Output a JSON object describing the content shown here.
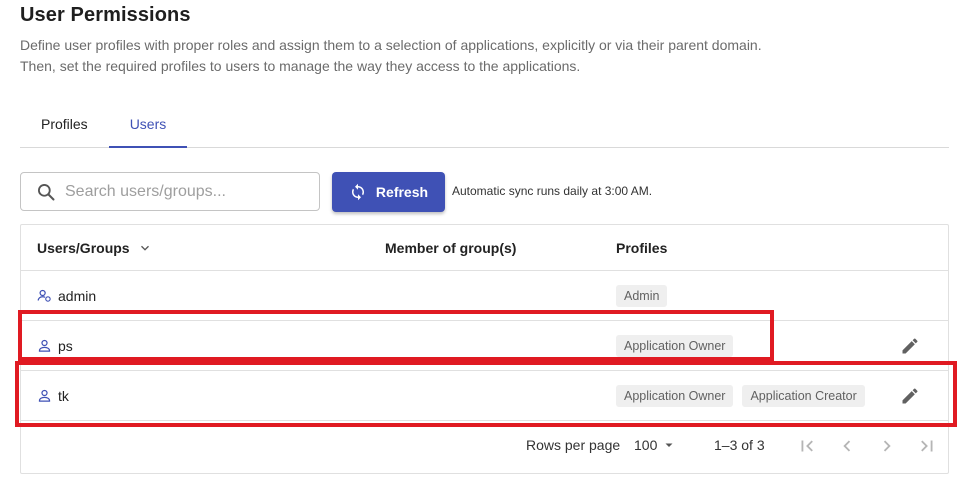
{
  "page": {
    "title": "User Permissions",
    "description_line1": "Define user profiles with proper roles and assign them to a selection of applications, explicitly or via their parent domain.",
    "description_line2": "Then, set the required profiles to users to manage the way they access to the applications."
  },
  "tabs": [
    {
      "label": "Profiles",
      "active": false
    },
    {
      "label": "Users",
      "active": true
    }
  ],
  "search": {
    "placeholder": "Search users/groups...",
    "value": ""
  },
  "refresh": {
    "label": "Refresh",
    "note": "Automatic sync runs daily at 3:00 AM."
  },
  "table": {
    "columns": [
      "Users/Groups",
      "Member of group(s)",
      "Profiles"
    ],
    "rows": [
      {
        "name": "admin",
        "icon": "user-group-icon",
        "profiles": [
          "Admin"
        ],
        "editable": false
      },
      {
        "name": "ps",
        "icon": "user-icon",
        "profiles": [
          "Application Owner"
        ],
        "editable": true
      },
      {
        "name": "tk",
        "icon": "user-icon",
        "profiles": [
          "Application Owner",
          "Application Creator"
        ],
        "editable": true
      }
    ]
  },
  "pagination": {
    "rows_per_page_label": "Rows per page",
    "rows_per_page": "100",
    "range": "1–3 of 3"
  },
  "colors": {
    "accent": "#3f51b5",
    "highlight": "#e01a22"
  }
}
